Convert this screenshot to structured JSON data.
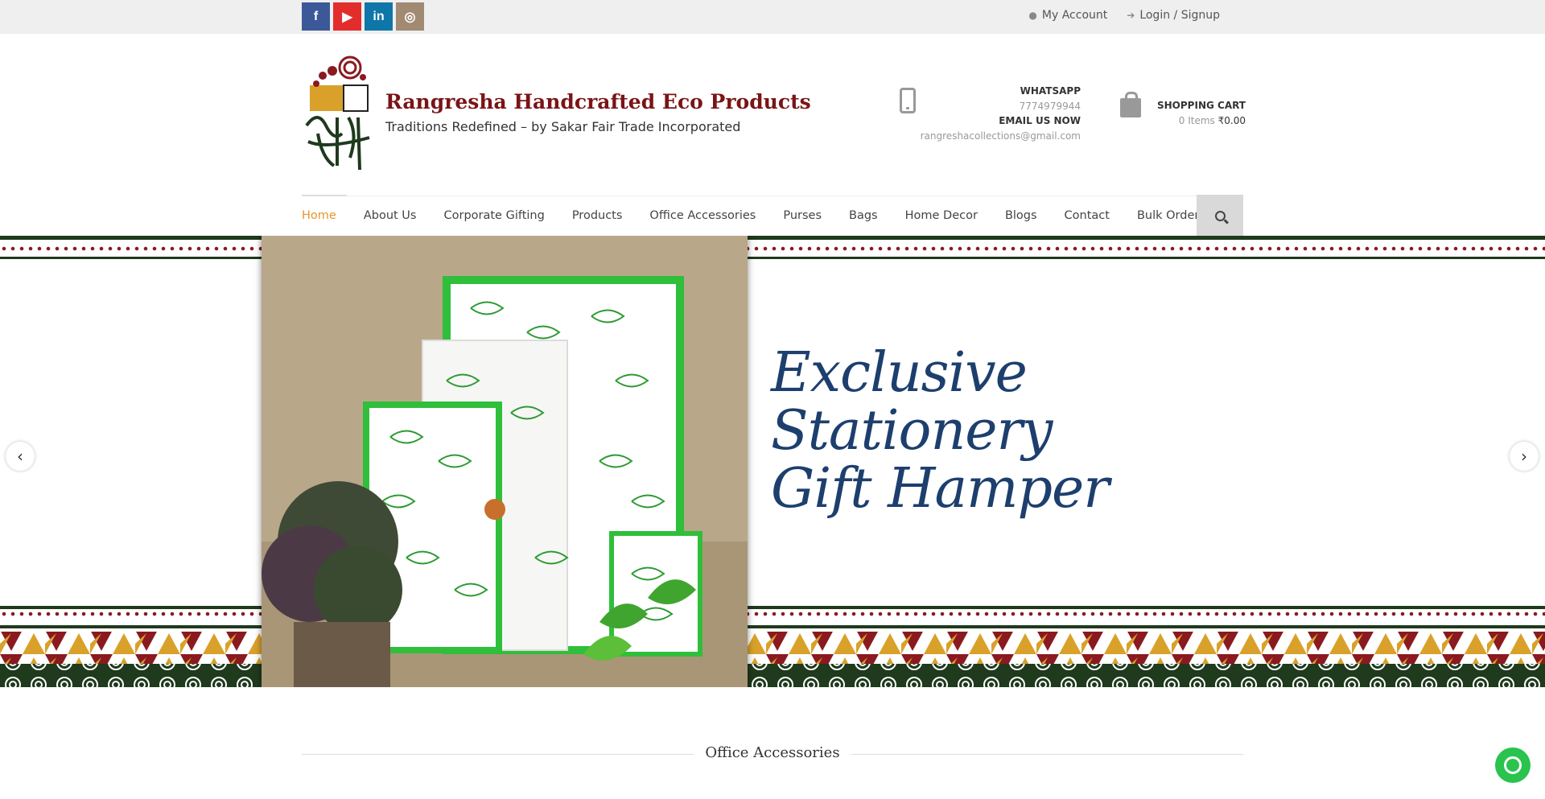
{
  "topbar": {
    "social": [
      {
        "name": "facebook",
        "glyph": "f"
      },
      {
        "name": "youtube",
        "glyph": "▶"
      },
      {
        "name": "linkedin",
        "glyph": "in"
      },
      {
        "name": "instagram",
        "glyph": "◎"
      }
    ],
    "my_account": "My Account",
    "login": "Login / Signup"
  },
  "header": {
    "title": "Rangresha Handcrafted Eco Products",
    "subtitle": "Traditions Redefined – by Sakar Fair Trade Incorporated",
    "whatsapp_label": "WHATSAPP",
    "whatsapp_number": "7774979944",
    "email_label": "EMAIL US NOW",
    "email": "rangreshacollections@gmail.com",
    "cart_label": "SHOPPING CART",
    "cart_items": "0 Items",
    "cart_total": "₹0.00"
  },
  "nav": {
    "items": [
      "Home",
      "About Us",
      "Corporate Gifting",
      "Products",
      "Office Accessories",
      "Purses",
      "Bags",
      "Home Decor",
      "Blogs",
      "Contact",
      "Bulk Order"
    ],
    "active": "Home"
  },
  "slider": {
    "lines": [
      "Exclusive",
      "Stationery",
      "Gift Hamper"
    ],
    "prev": "‹",
    "next": "›"
  },
  "section": {
    "title": "Office Accessories"
  },
  "colors": {
    "brand": "#7a1416",
    "accent": "#e8962a",
    "slide_text": "#1d3f6e",
    "band_dark": "#1f3a1d",
    "band_red": "#8a1a1f",
    "band_mustard": "#d9a12a"
  }
}
